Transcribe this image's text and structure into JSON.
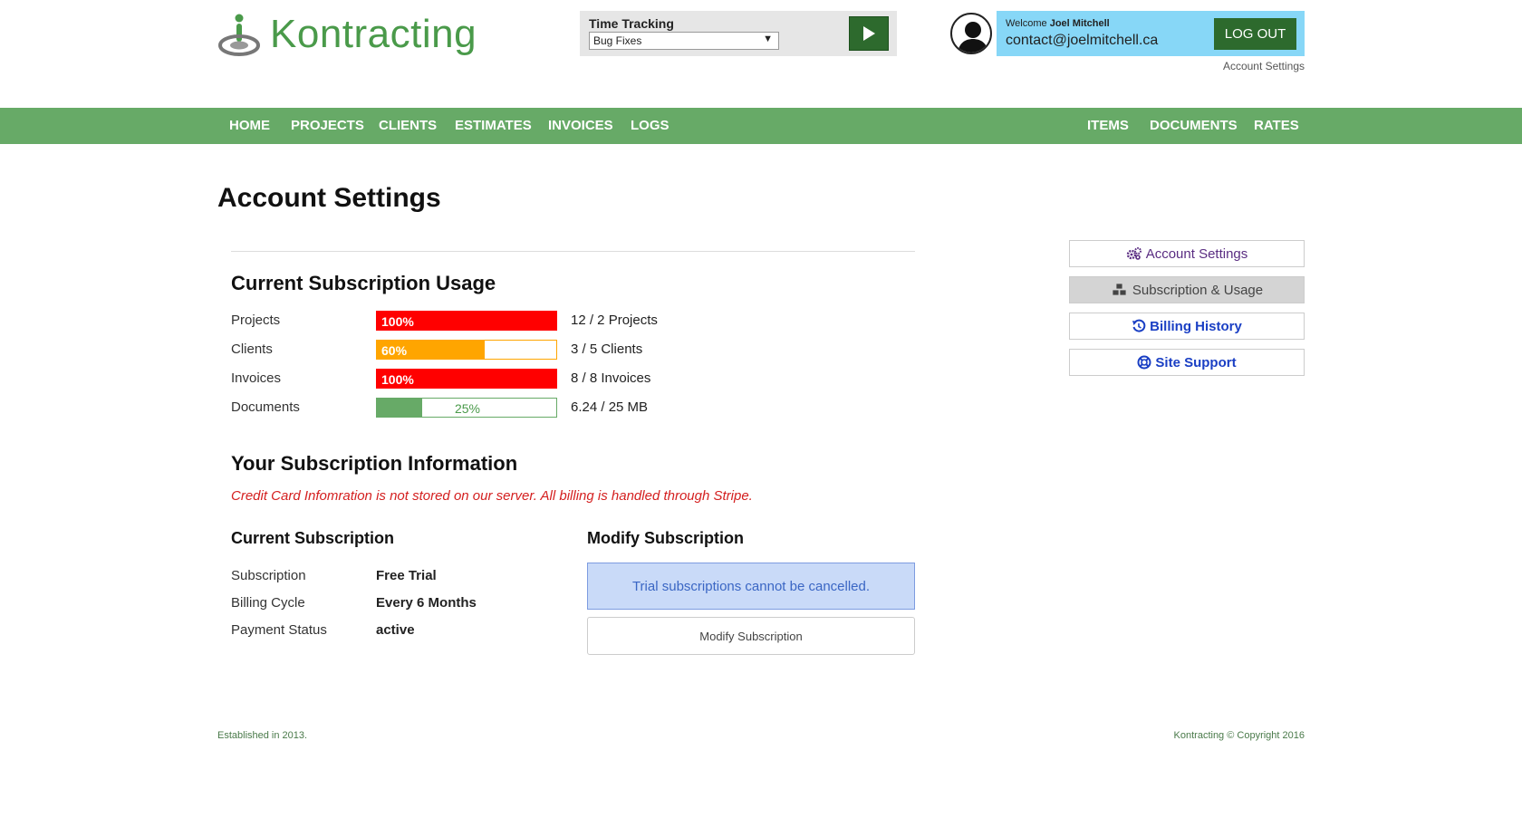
{
  "brand": {
    "name": "Kontracting",
    "color": "#4a9a4a"
  },
  "time_tracking": {
    "label": "Time Tracking",
    "selected": "Bug Fixes"
  },
  "user": {
    "welcome_prefix": "Welcome",
    "name": "Joel Mitchell",
    "email": "contact@joelmitchell.ca",
    "logout_label": "LOG OUT",
    "account_settings_link": "Account Settings"
  },
  "nav": {
    "left": [
      "HOME",
      "PROJECTS",
      "CLIENTS",
      "ESTIMATES",
      "INVOICES",
      "LOGS"
    ],
    "right": [
      "ITEMS",
      "DOCUMENTS",
      "RATES"
    ]
  },
  "page": {
    "title": "Account Settings"
  },
  "usage": {
    "heading": "Current Subscription Usage",
    "rows": [
      {
        "label": "Projects",
        "percent": 100,
        "percent_label": "100%",
        "value": "12 / 2 Projects",
        "color": "#ff0000"
      },
      {
        "label": "Clients",
        "percent": 60,
        "percent_label": "60%",
        "value": "3 / 5 Clients",
        "color": "#ffa500"
      },
      {
        "label": "Invoices",
        "percent": 100,
        "percent_label": "100%",
        "value": "8 / 8 Invoices",
        "color": "#ff0000"
      },
      {
        "label": "Documents",
        "percent": 25,
        "percent_label": "25%",
        "value": "6.24 / 25 MB",
        "color": "#67aa67"
      }
    ]
  },
  "subscription": {
    "heading": "Your Subscription Information",
    "notice": "Credit Card Infomration is not stored on our server. All billing is handled through Stripe.",
    "current_heading": "Current Subscription",
    "fields": [
      {
        "label": "Subscription",
        "value": "Free Trial"
      },
      {
        "label": "Billing Cycle",
        "value": "Every 6 Months"
      },
      {
        "label": "Payment Status",
        "value": "active"
      }
    ],
    "modify_heading": "Modify Subscription",
    "alert": "Trial subscriptions cannot be cancelled.",
    "modify_button": "Modify Subscription"
  },
  "sidebar": {
    "items": [
      {
        "label": "Account Settings",
        "icon": "gears-icon",
        "color": "#5a2d82",
        "active": false
      },
      {
        "label": "Subscription & Usage",
        "icon": "cubes-icon",
        "color": "#444444",
        "active": true
      },
      {
        "label": "Billing History",
        "icon": "history-icon",
        "color": "#1a3fc4",
        "active": false
      },
      {
        "label": "Site Support",
        "icon": "lifebuoy-icon",
        "color": "#1a3fc4",
        "active": false
      }
    ]
  },
  "footer": {
    "left": "Established in 2013.",
    "right": "Kontracting © Copyright 2016"
  }
}
